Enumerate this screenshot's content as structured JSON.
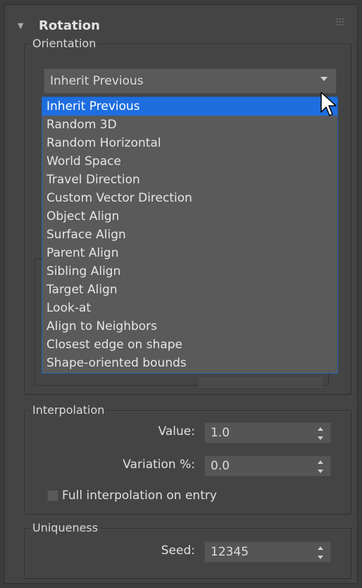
{
  "rollout": {
    "title": "Rotation"
  },
  "orientation": {
    "legend": "Orientation",
    "selected": "Inherit Previous",
    "options": [
      "Inherit Previous",
      "Random 3D",
      "Random Horizontal",
      "World Space",
      "Travel Direction",
      "Custom Vector Direction",
      "Object Align",
      "Surface Align",
      "Parent Align",
      "Sibling Align",
      "Target Align",
      "Look-at",
      "Align to Neighbors",
      "Closest edge on shape",
      "Shape-oriented bounds"
    ],
    "highlighted_index": 0
  },
  "interpolation": {
    "legend": "Interpolation",
    "value_label": "Value:",
    "value": "1.0",
    "variation_label": "Variation %:",
    "variation": "0.0",
    "full_interp_label": "Full interpolation on entry",
    "full_interp_checked": false
  },
  "uniqueness": {
    "legend": "Uniqueness",
    "seed_label": "Seed:",
    "seed": "12345"
  },
  "colors": {
    "panel_bg": "#444444",
    "accent_selected": "#1e6ee0",
    "list_border": "#1f62b5"
  }
}
